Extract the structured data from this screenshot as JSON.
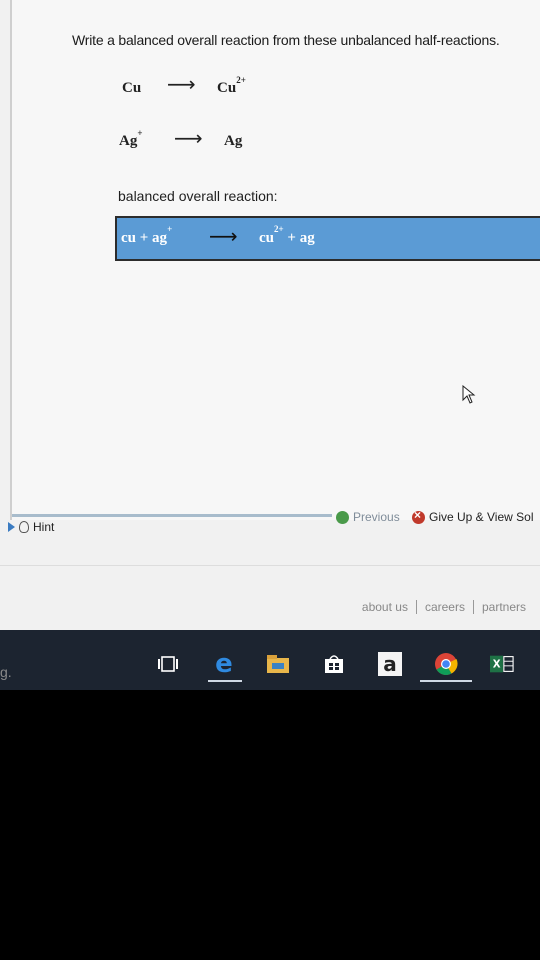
{
  "question": "Write a balanced overall reaction from these unbalanced half-reactions.",
  "half_reactions": [
    {
      "reactant": "Cu",
      "reactant_charge": "",
      "arrow": "⟶",
      "product": "Cu",
      "product_charge": "2+"
    },
    {
      "reactant": "Ag",
      "reactant_charge": "+",
      "arrow": "⟶",
      "product": "Ag",
      "product_charge": ""
    }
  ],
  "balanced_label": "balanced overall reaction:",
  "answer": {
    "left": "cu + ag",
    "left_charge": "+",
    "arrow": "⟶",
    "right_species": "cu",
    "right_charge": "2+",
    "right_rest": "+ ag"
  },
  "nav": {
    "hint": "Hint",
    "previous": "Previous",
    "give_up": "Give Up & View Sol"
  },
  "footer": {
    "links": [
      "about us",
      "careers",
      "partners"
    ]
  },
  "taskbar": {
    "search_text": "g."
  },
  "colors": {
    "answer_bg": "#5b9bd5",
    "taskbar_bg": "#1c2430"
  }
}
